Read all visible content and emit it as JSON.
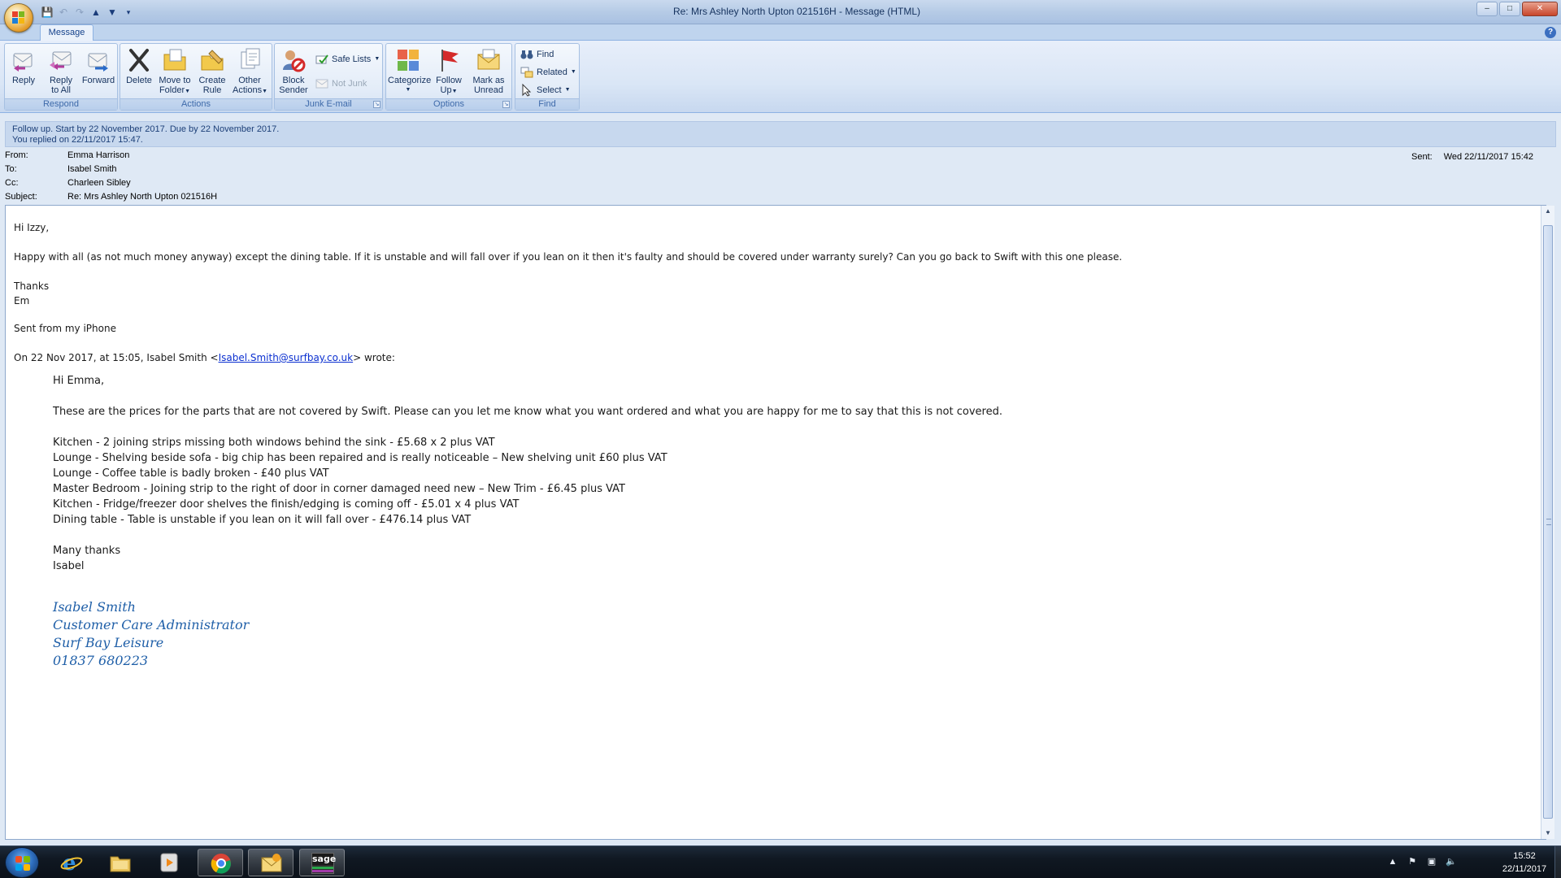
{
  "window": {
    "title": "Re: Mrs Ashley North Upton 021516H - Message (HTML)",
    "minimize": "–",
    "maximize": "□",
    "close": "✕"
  },
  "ribbon": {
    "tab": "Message",
    "groups": {
      "respond": {
        "label": "Respond",
        "reply": "Reply",
        "reply_all_1": "Reply",
        "reply_all_2": "to All",
        "forward": "Forward"
      },
      "actions": {
        "label": "Actions",
        "delete": "Delete",
        "move_1": "Move to",
        "move_2": "Folder",
        "rule_1": "Create",
        "rule_2": "Rule",
        "other_1": "Other",
        "other_2": "Actions"
      },
      "junk": {
        "label": "Junk E-mail",
        "block_1": "Block",
        "block_2": "Sender",
        "safe_lists": "Safe Lists",
        "not_junk": "Not Junk"
      },
      "options": {
        "label": "Options",
        "categorize": "Categorize",
        "follow_1": "Follow",
        "follow_2": "Up",
        "mark_1": "Mark as",
        "mark_2": "Unread"
      },
      "find": {
        "label": "Find",
        "find": "Find",
        "related": "Related",
        "select": "Select"
      }
    }
  },
  "infobar": {
    "line1": "Follow up.  Start by 22 November 2017.  Due by 22 November 2017.",
    "line2": "You replied on 22/11/2017 15:47."
  },
  "headers": {
    "from_label": "From:",
    "from": "Emma Harrison",
    "to_label": "To:",
    "to": "Isabel Smith",
    "cc_label": "Cc:",
    "cc": "Charleen Sibley",
    "subject_label": "Subject:",
    "subject": "Re: Mrs Ashley North Upton 021516H",
    "sent_label": "Sent:",
    "sent": "Wed 22/11/2017 15:42"
  },
  "message": {
    "greeting": "Hi Izzy,",
    "para1": "Happy with all (as not much money anyway) except the dining table. If it is unstable and will fall over if you lean on it then it's faulty and should be covered under warranty surely? Can you go back to Swift with this one please.",
    "thanks": "Thanks",
    "name": "Em",
    "sent_from": "Sent from my iPhone",
    "wrote_prefix": "On 22 Nov 2017, at 15:05, Isabel Smith <",
    "wrote_email": "Isabel.Smith@surfbay.co.uk",
    "wrote_suffix": "> wrote:",
    "quoted": {
      "greeting": "Hi Emma,",
      "intro": "These are the prices for the parts that are not covered by Swift. Please can you let me know what you want ordered and what you are happy for me to say that this is not covered.",
      "items": [
        "Kitchen - 2 joining strips missing both windows behind the sink - £5.68 x 2 plus VAT",
        "Lounge - Shelving beside sofa - big chip has been repaired and is really noticeable – New shelving unit £60 plus VAT",
        "Lounge - Coffee table is badly broken - £40 plus VAT",
        "Master Bedroom - Joining strip to the right of door in corner damaged need new – New Trim - £6.45 plus VAT",
        "Kitchen - Fridge/freezer door shelves the finish/edging is coming off - £5.01 x 4 plus VAT",
        "Dining table - Table is unstable if you lean on it will fall over - £476.14 plus VAT"
      ],
      "closing": "Many thanks",
      "signoff": "Isabel",
      "signature": {
        "name": "Isabel Smith",
        "role": "Customer Care Administrator",
        "company": "Surf Bay Leisure",
        "phone": "01837 680223"
      }
    }
  },
  "taskbar": {
    "apps": [
      "internet-explorer",
      "file-explorer",
      "media-player",
      "chrome",
      "outlook",
      "sage"
    ],
    "sage_label": "sage",
    "time": "15:52",
    "date": "22/11/2017"
  },
  "colors": {
    "ribbon_accent": "#3e6aaa",
    "link": "#0a2fd0",
    "signature": "#1f5fa8"
  }
}
